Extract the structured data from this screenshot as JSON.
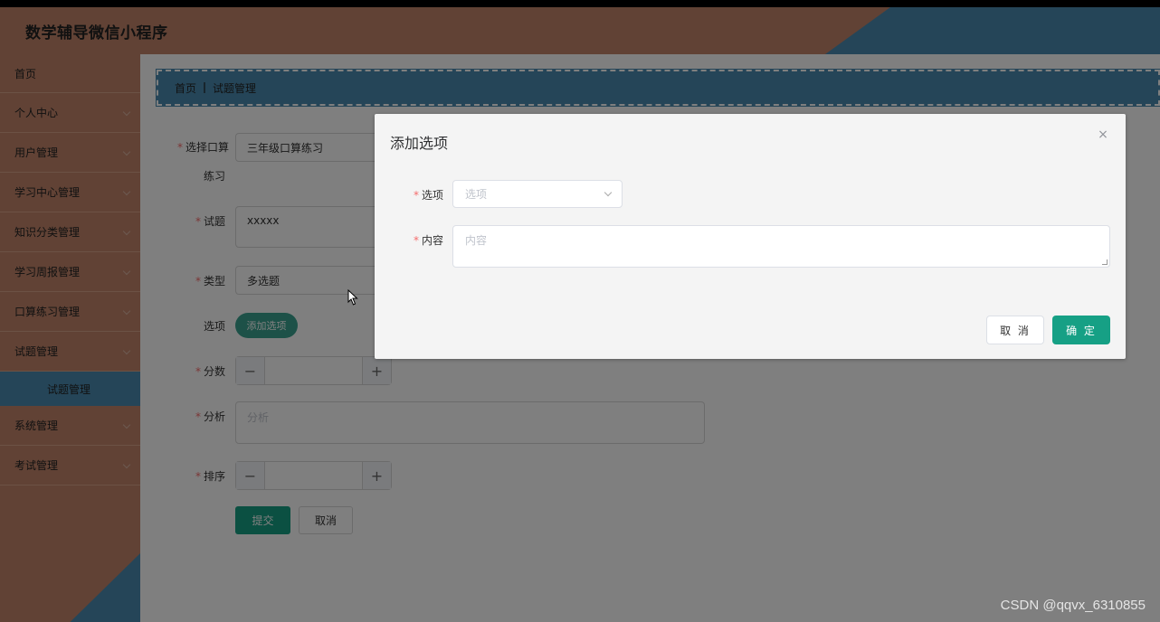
{
  "app": {
    "title": "数学辅导微信小程序"
  },
  "sidebar": {
    "items": [
      {
        "label": "首页"
      },
      {
        "label": "个人中心"
      },
      {
        "label": "用户管理"
      },
      {
        "label": "学习中心管理"
      },
      {
        "label": "知识分类管理"
      },
      {
        "label": "学习周报管理"
      },
      {
        "label": "口算练习管理"
      },
      {
        "label": "试题管理"
      }
    ],
    "active_sub": "试题管理",
    "items_after": [
      {
        "label": "系统管理"
      },
      {
        "label": "考试管理"
      }
    ]
  },
  "breadcrumb": {
    "home": "首页",
    "current": "试题管理"
  },
  "form": {
    "select_label_1": "选择口算",
    "select_label_2": "练习",
    "select_value": "三年级口算练习",
    "question_label": "试题",
    "question_value": "xxxxx",
    "type_label": "类型",
    "type_value": "多选题",
    "options_label": "选项",
    "add_option_button": "添加选项",
    "score_label": "分数",
    "analysis_label": "分析",
    "analysis_placeholder": "分析",
    "sort_label": "排序",
    "submit_button": "提交",
    "cancel_button": "取消",
    "minus": "−",
    "plus": "+"
  },
  "dialog": {
    "title": "添加选项",
    "close": "×",
    "option_label": "选项",
    "option_placeholder": "选项",
    "content_label": "内容",
    "content_placeholder": "内容",
    "cancel_button": "取 消",
    "confirm_button": "确 定"
  },
  "required_mark": "*",
  "watermark": "CSDN @qqvx_6310855"
}
